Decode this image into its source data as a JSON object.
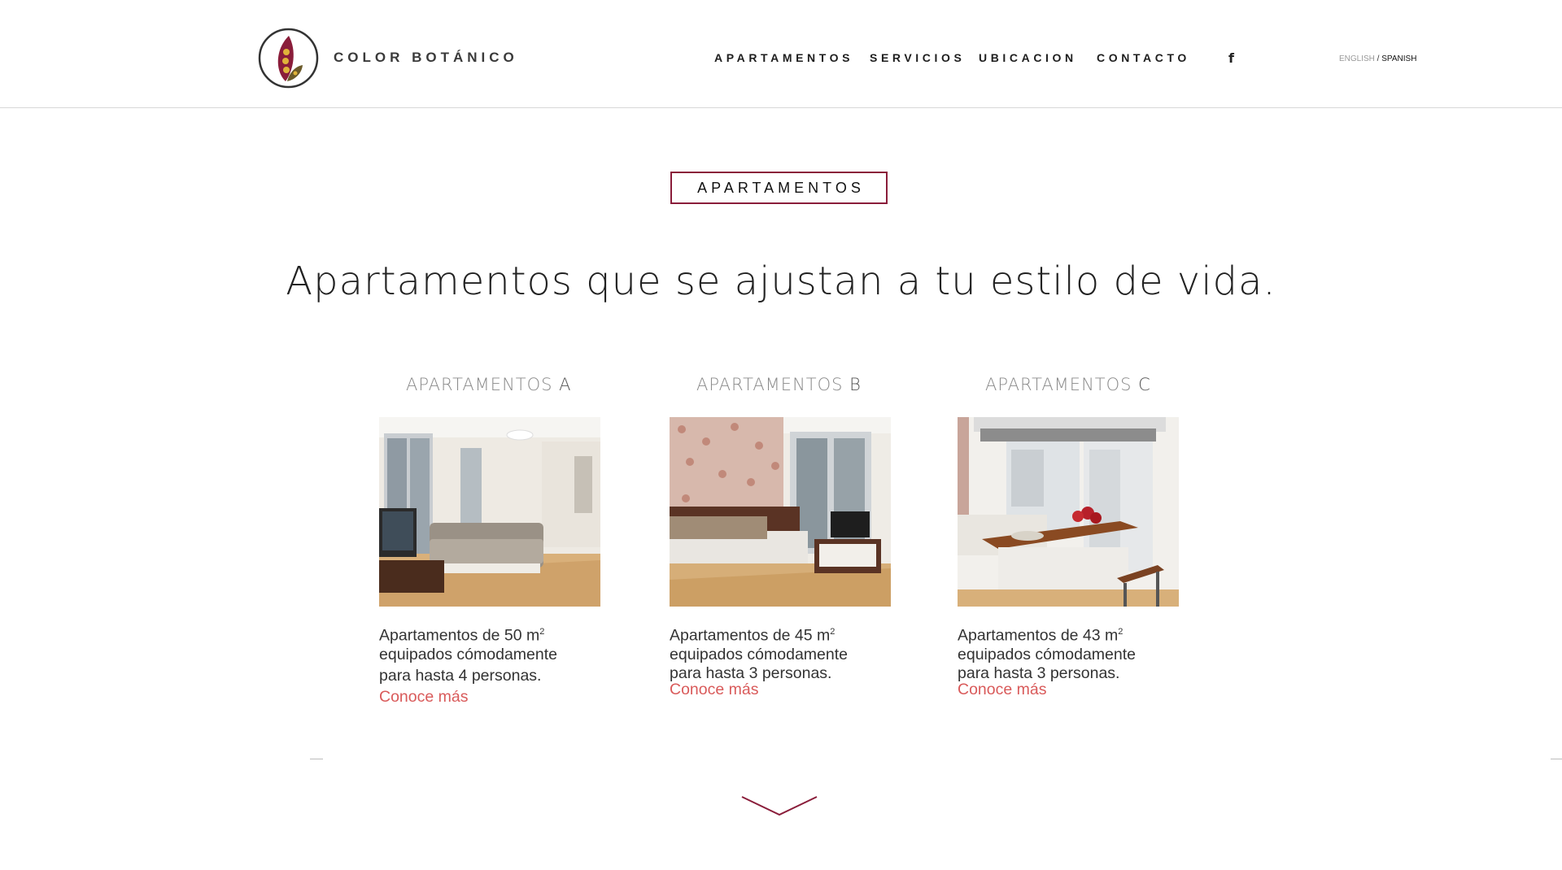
{
  "header": {
    "brand": "COLOR BOTÁNICO",
    "nav": [
      {
        "label": "APARTAMENTOS"
      },
      {
        "label": "SERVICIOS"
      },
      {
        "label": "UBICACION"
      },
      {
        "label": "CONTACTO"
      }
    ],
    "social_icon": "facebook-icon",
    "facebook_glyph": "f",
    "lang_english": "ENGLISH",
    "lang_sep": " / ",
    "lang_spanish": "SPANISH"
  },
  "section": {
    "badge": "APARTAMENTOS",
    "headline": "Apartamentos que se ajustan a tu estilo de vida."
  },
  "cards": [
    {
      "title_prefix": "APARTAMENTOS ",
      "title_letter": "A",
      "line1": "Apartamentos de 50 m",
      "sup": "2",
      "line2": "equipados cómodamente",
      "line3": "para hasta 4 personas.",
      "link": "Conoce más"
    },
    {
      "title_prefix": "APARTAMENTOS ",
      "title_letter": "B",
      "line1": "Apartamentos de 45 m",
      "sup": "2",
      "line2": "equipados cómodamente",
      "line3": "para hasta 3 personas.",
      "link": "Conoce más"
    },
    {
      "title_prefix": "APARTAMENTOS ",
      "title_letter": "C",
      "line1": "Apartamentos de 43 m",
      "sup": "2",
      "line2": "equipados cómodamente",
      "line3": "para hasta 3 personas.",
      "link": "Conoce más"
    }
  ],
  "colors": {
    "accent": "#8a1d3a",
    "link": "#d95a5a"
  },
  "icons": {
    "scroll": "chevron-down-icon",
    "logo": "logo-icon"
  }
}
